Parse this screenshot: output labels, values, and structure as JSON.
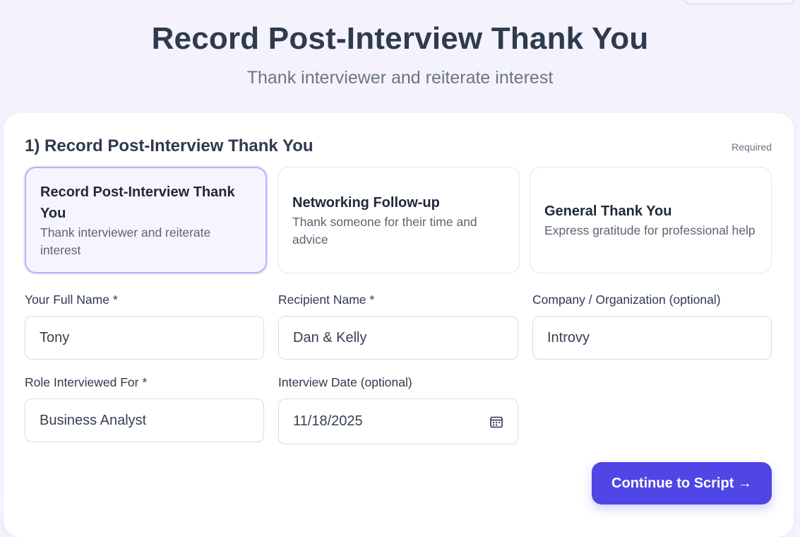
{
  "header": {
    "title": "Record Post-Interview Thank You",
    "subtitle": "Thank interviewer and reiterate interest"
  },
  "section": {
    "title": "1) Record Post-Interview Thank You",
    "required_label": "Required"
  },
  "options": [
    {
      "title": "Record Post-Interview Thank You",
      "description": "Thank interviewer and reiterate interest",
      "selected": true
    },
    {
      "title": "Networking Follow-up",
      "description": "Thank someone for their time and advice",
      "selected": false
    },
    {
      "title": "General Thank You",
      "description": "Express gratitude for professional help",
      "selected": false
    }
  ],
  "form": {
    "full_name": {
      "label": "Your Full Name *",
      "value": "Tony"
    },
    "recipient_name": {
      "label": "Recipient Name *",
      "value": "Dan & Kelly"
    },
    "company": {
      "label": "Company / Organization (optional)",
      "value": "Introvy"
    },
    "role": {
      "label": "Role Interviewed For *",
      "value": "Business Analyst"
    },
    "interview_date": {
      "label": "Interview Date (optional)",
      "value": "11/18/2025",
      "icon": "calendar-icon"
    }
  },
  "actions": {
    "continue_label": "Continue to Script →"
  },
  "colors": {
    "accent": "#4f46e5",
    "selected_border": "#b8b1f5",
    "selected_bg": "#f6f5ff"
  }
}
